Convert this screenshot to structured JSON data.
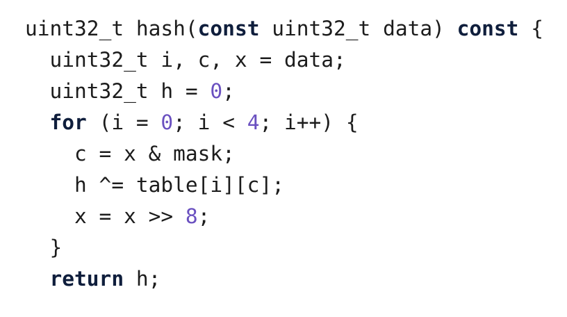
{
  "code": {
    "language": "C++",
    "colors": {
      "text": "#1c1c1c",
      "keyword": "#0f1e3c",
      "number": "#6a50c0"
    },
    "lines": [
      {
        "indent": 0,
        "tokens": [
          [
            "uint32_t hash(",
            "plain"
          ],
          [
            "const",
            "kw"
          ],
          [
            " uint32_t data) ",
            "plain"
          ],
          [
            "const",
            "kw"
          ],
          [
            " {",
            "plain"
          ]
        ]
      },
      {
        "indent": 1,
        "tokens": [
          [
            "uint32_t i, c, x = data;",
            "plain"
          ]
        ]
      },
      {
        "indent": 1,
        "tokens": [
          [
            "uint32_t h = ",
            "plain"
          ],
          [
            "0",
            "num"
          ],
          [
            ";",
            "plain"
          ]
        ]
      },
      {
        "indent": 1,
        "tokens": [
          [
            "for",
            "kw"
          ],
          [
            " (i = ",
            "plain"
          ],
          [
            "0",
            "num"
          ],
          [
            "; i < ",
            "plain"
          ],
          [
            "4",
            "num"
          ],
          [
            "; i++) {",
            "plain"
          ]
        ]
      },
      {
        "indent": 2,
        "tokens": [
          [
            "c = x & mask;",
            "plain"
          ]
        ]
      },
      {
        "indent": 2,
        "tokens": [
          [
            "h ^= table[i][c];",
            "plain"
          ]
        ]
      },
      {
        "indent": 2,
        "tokens": [
          [
            "x = x >> ",
            "plain"
          ],
          [
            "8",
            "num"
          ],
          [
            ";",
            "plain"
          ]
        ]
      },
      {
        "indent": 1,
        "tokens": [
          [
            "}",
            "plain"
          ]
        ]
      },
      {
        "indent": 1,
        "tokens": [
          [
            "return",
            "kw"
          ],
          [
            " h;",
            "plain"
          ]
        ]
      }
    ]
  }
}
